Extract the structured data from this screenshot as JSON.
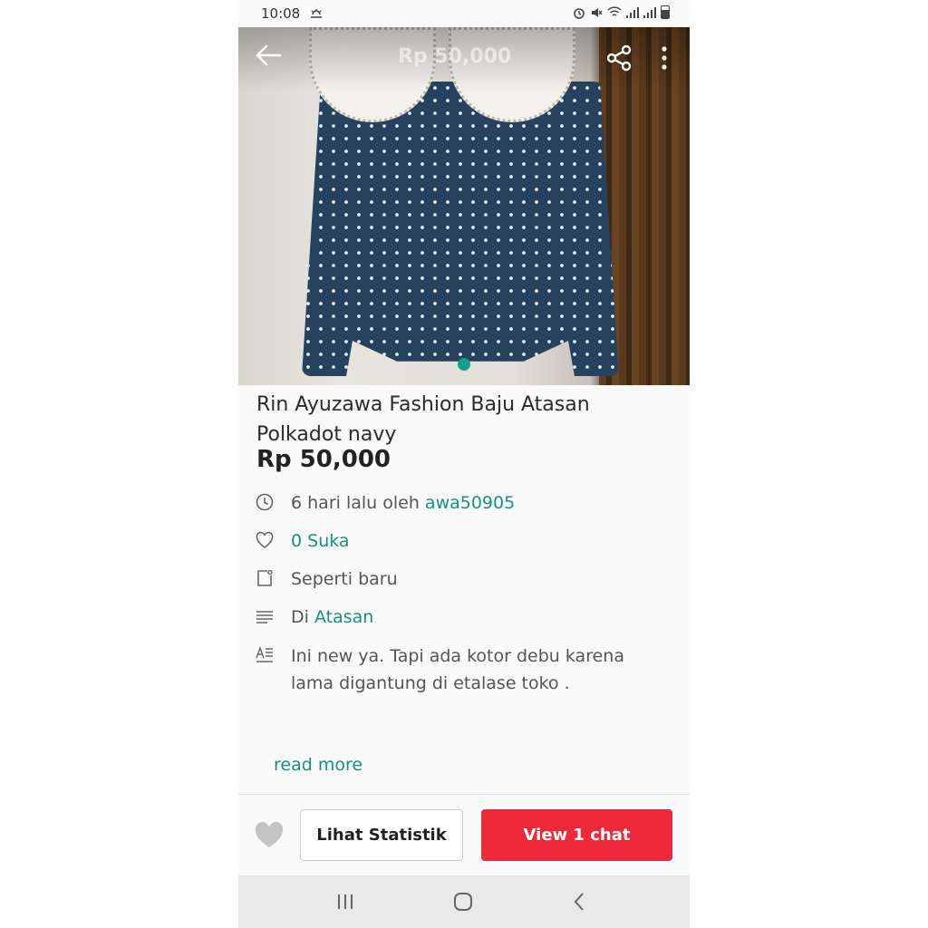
{
  "status_bar": {
    "time": "10:08"
  },
  "top_nav": {
    "title_price": "Rp 50,000",
    "icons": [
      "back-arrow-icon",
      "share-icon",
      "more-vert-icon"
    ]
  },
  "product": {
    "title": "Rin Ayuzawa Fashion Baju Atasan Polkadot navy",
    "price": "Rp 50,000",
    "image_count": 1
  },
  "details": {
    "posted_text": "6 hari lalu oleh",
    "seller": "awa50905",
    "likes": "0 Suka",
    "condition": "Seperti baru",
    "category_prefix": "Di",
    "category": "Atasan",
    "description": "Ini new ya. Tapi ada kotor debu karena lama digantung di etalase toko ."
  },
  "read_more": "read more",
  "actions": {
    "stats_label": "Lihat Statistik",
    "chat_label": "View 1 chat"
  },
  "colors": {
    "accent": "#13927f",
    "chat_button": "#ee2a3a"
  }
}
